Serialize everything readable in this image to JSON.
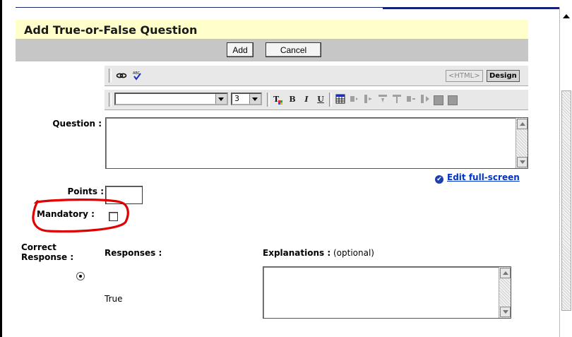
{
  "title": "Add True-or-False Question",
  "buttons": {
    "add": "Add",
    "cancel": "Cancel"
  },
  "editor": {
    "view_toggle_html": "<HTML>",
    "view_toggle_design": "Design",
    "font_size_value": "3",
    "icons": [
      "link-icon",
      "spellcheck-icon",
      "text-color-icon",
      "bold-icon",
      "italic-icon",
      "underline-icon",
      "table-icon"
    ]
  },
  "form": {
    "question_label": "Question :",
    "edit_fullscreen": "Edit full-screen",
    "points_label": "Points :",
    "mandatory_label": "Mandatory :",
    "correct_response_label_line1": "Correct",
    "correct_response_label_line2": "Response :",
    "responses_label": "Responses :",
    "explanations_label": "Explanations :",
    "explanations_hint": "(optional)",
    "response_true": "True"
  },
  "annotation": {
    "highlight_color": "#e00000"
  }
}
